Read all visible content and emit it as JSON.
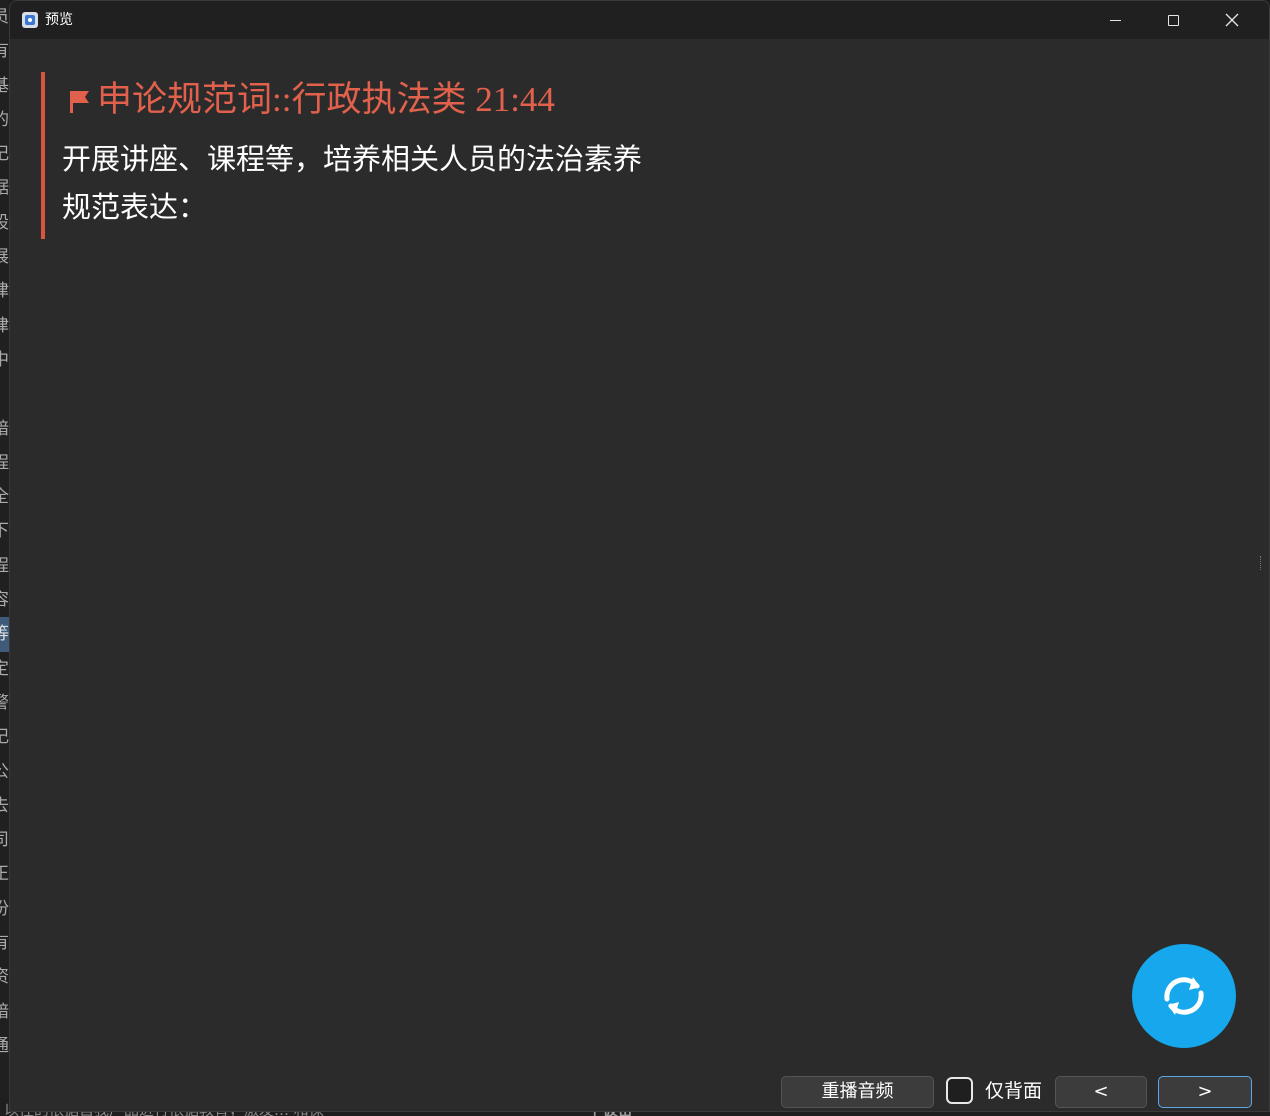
{
  "background_app": {
    "side_chars": [
      "员",
      "有",
      "基",
      "的",
      "记",
      "据",
      "股",
      "展",
      "律",
      "律",
      "中",
      "",
      "暗",
      "程",
      "全",
      "下",
      "程",
      "容",
      "等",
      "定",
      "警",
      "记",
      "公",
      "去",
      "司",
      "正",
      "份",
      "有",
      "资",
      "暗",
      "通"
    ],
    "bottom_text": "以往的依据自我广品进行依据教育，激发…    和保",
    "bottom_subtitle": "| 仮密"
  },
  "window": {
    "title": "预览",
    "minimize_label": "",
    "maximize_label": "",
    "close_label": ""
  },
  "card": {
    "title": "申论规范词::行政执法类 21:44",
    "line1": "开展讲座、课程等，培养相关人员的法治素养",
    "line2": "规范表达："
  },
  "controls": {
    "replay_label": "重播音频",
    "back_only_label": "仅背面",
    "back_only_checked": false,
    "prev_label": "<",
    "next_label": ">"
  },
  "colors": {
    "accent_red": "#e2614c",
    "border_red": "#d9553f",
    "fab_blue": "#16a7ec",
    "window_bg": "#2b2b2b",
    "titlebar_bg": "#202020"
  },
  "icons": {
    "flag": "flag-icon",
    "refresh": "refresh-icon",
    "app": "app-icon"
  }
}
